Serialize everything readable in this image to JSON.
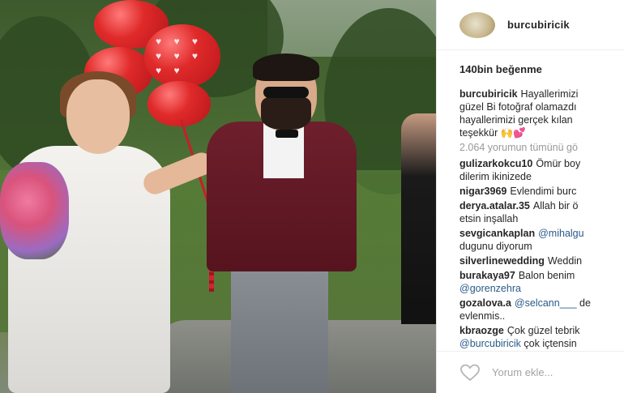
{
  "post": {
    "username": "burcubiricik",
    "likes": "140bin beğenme",
    "caption": {
      "username": "burcubiricik",
      "lines": [
        "Hayallerimizi",
        "güzel Bi fotoğraf olamazdı",
        "hayallerimizi gerçek kılan",
        "teşekkür 🙌💕"
      ]
    },
    "view_all_comments": "2.064 yorumun tümünü gö",
    "comments": [
      {
        "username": "gulizarkokcu10",
        "lines": [
          "Ömür boy",
          "dilerim ikinizede"
        ]
      },
      {
        "username": "nigar3969",
        "lines": [
          "Evlendimi burc"
        ]
      },
      {
        "username": "derya.atalar.35",
        "lines": [
          "Allah bir ö",
          "etsin inşallah"
        ]
      },
      {
        "username": "sevgicankaplan",
        "mention": "@mihalgu",
        "lines": [
          "dugunu diyorum"
        ]
      },
      {
        "username": "silverlinewedding",
        "lines": [
          "Weddin"
        ]
      },
      {
        "username": "burakaya97",
        "lines": [
          "Balon benim"
        ],
        "mention2": "@gorenzehra"
      },
      {
        "username": "gozalova.a",
        "mention": "@selcann___",
        "tail": "de",
        "lines": [
          "evlenmis.."
        ]
      },
      {
        "username": "kbraozge",
        "lines": [
          "Çok güzel tebrik"
        ],
        "mention2": "@burcubiricik",
        "tail2": "çok içtensin"
      }
    ],
    "comment_placeholder": "Yorum ekle..."
  },
  "colors": {
    "text": "#262626",
    "muted": "#999999",
    "mention": "#2a5a88",
    "balloon": "#e02a2a"
  }
}
